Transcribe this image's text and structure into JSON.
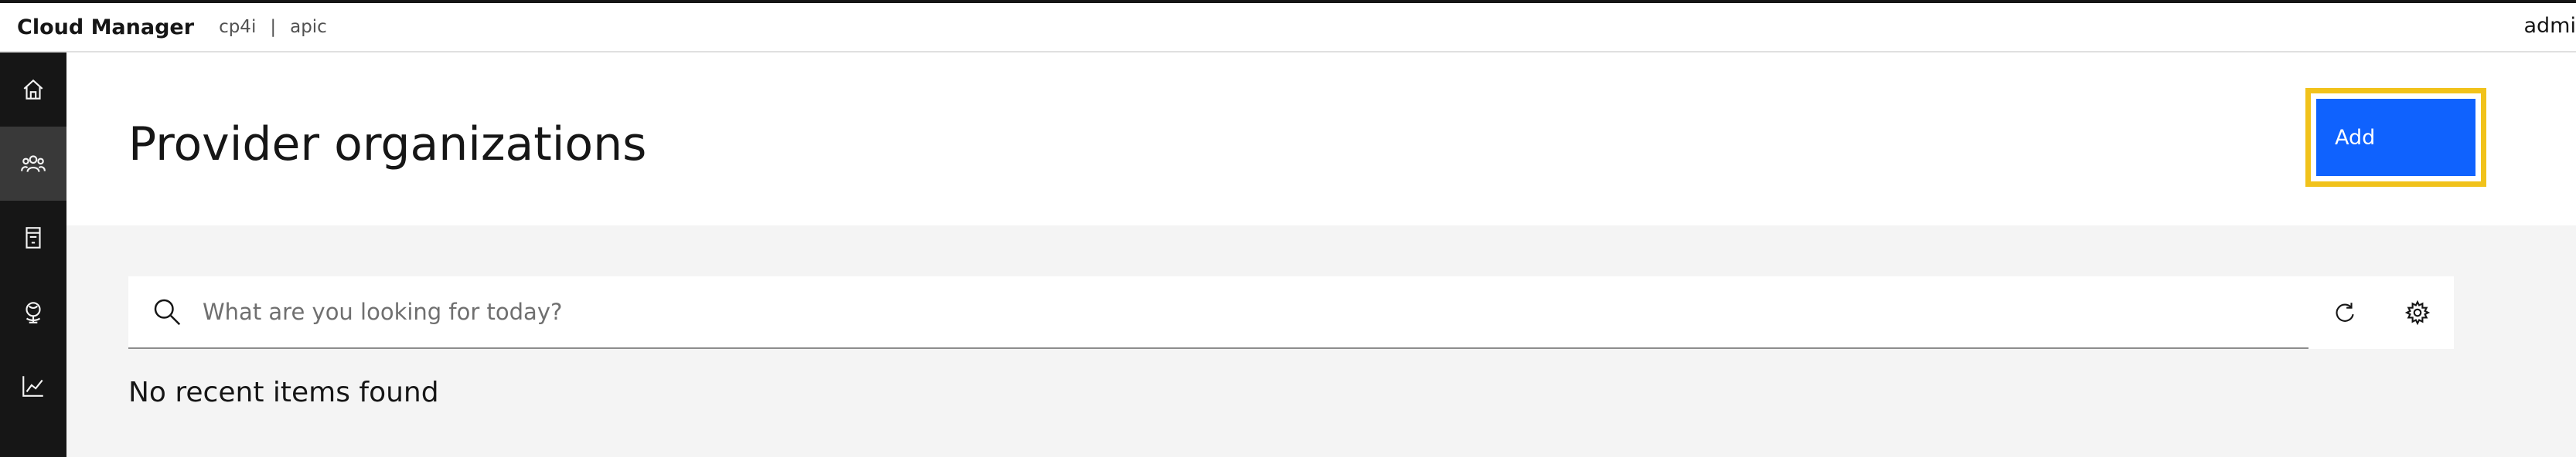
{
  "header": {
    "brand": "Cloud Manager",
    "breadcrumb": [
      "cp4i",
      "apic"
    ],
    "separator": "|",
    "user": "admi"
  },
  "rail": {
    "items": [
      {
        "icon": "home-icon",
        "active": false
      },
      {
        "icon": "users-icon",
        "active": true
      },
      {
        "icon": "catalog-icon",
        "active": false
      },
      {
        "icon": "globe-icon",
        "active": false
      },
      {
        "icon": "analytics-icon",
        "active": false
      }
    ]
  },
  "page": {
    "title": "Provider organizations",
    "add_label": "Add"
  },
  "search": {
    "placeholder": "What are you looking for today?",
    "value": ""
  },
  "empty_message": "No recent items found",
  "colors": {
    "primary": "#0f62fe",
    "focus_highlight": "#f1c21b",
    "rail_bg": "#161616",
    "rail_active": "#393939",
    "page_bg": "#f4f4f4"
  }
}
